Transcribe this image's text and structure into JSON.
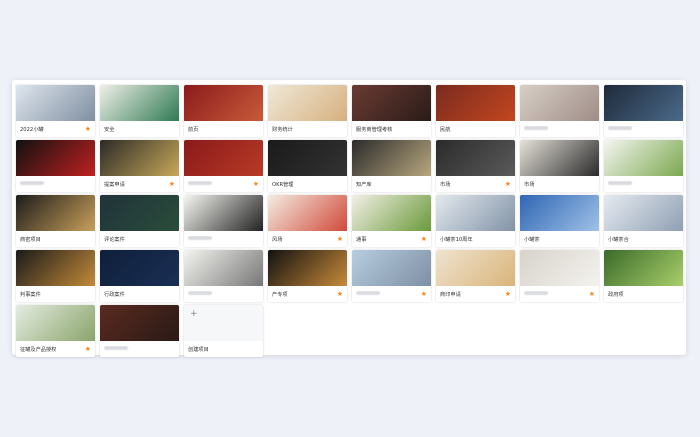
{
  "projects": [
    {
      "title": "2022小罐",
      "starred": true,
      "colors": [
        "#dfe6ee",
        "#7f8fa1"
      ]
    },
    {
      "title": "安全",
      "starred": false,
      "colors": [
        "#f0efe8",
        "#2f7a53"
      ]
    },
    {
      "title": "前页",
      "starred": false,
      "colors": [
        "#8b1b1b",
        "#c85a3a"
      ]
    },
    {
      "title": "财务统计",
      "starred": false,
      "colors": [
        "#efe8d8",
        "#d6b07e"
      ]
    },
    {
      "title": "服务商管理考核",
      "starred": false,
      "colors": [
        "#6a3b32",
        "#2b1b18"
      ]
    },
    {
      "title": "民航",
      "starred": false,
      "colors": [
        "#7a2a1f",
        "#c3471f"
      ]
    },
    {
      "title": "",
      "starred": false,
      "colors": [
        "#d7cfc7",
        "#9f8d86"
      ]
    },
    {
      "title": "",
      "starred": false,
      "colors": [
        "#1f2a3a",
        "#4b6a8a"
      ]
    },
    {
      "title": "",
      "starred": false,
      "colors": [
        "#111",
        "#c02020"
      ]
    },
    {
      "title": "提案申请",
      "starred": true,
      "colors": [
        "#2b2a27",
        "#c8a85a"
      ]
    },
    {
      "title": "",
      "starred": true,
      "colors": [
        "#8a1a1a",
        "#b83a26"
      ]
    },
    {
      "title": "OKR管理",
      "starred": false,
      "colors": [
        "#1a1a1a",
        "#333"
      ]
    },
    {
      "title": "知产库",
      "starred": false,
      "colors": [
        "#2b2b2b",
        "#b8a77e"
      ]
    },
    {
      "title": "市场",
      "starred": true,
      "colors": [
        "#2b2b2b",
        "#5a5a5a"
      ]
    },
    {
      "title": "市场",
      "starred": false,
      "colors": [
        "#e6e2da",
        "#2a2a2a"
      ]
    },
    {
      "title": "",
      "starred": false,
      "colors": [
        "#f5f5f2",
        "#7ba84e"
      ]
    },
    {
      "title": "商密项目",
      "starred": false,
      "colors": [
        "#1c1c1c",
        "#c9a05a"
      ]
    },
    {
      "title": "评论案件",
      "starred": false,
      "colors": [
        "#20323a",
        "#2a4d3a"
      ]
    },
    {
      "title": "",
      "starred": false,
      "colors": [
        "#f7f7f2",
        "#222"
      ]
    },
    {
      "title": "风场",
      "starred": true,
      "colors": [
        "#f3ece2",
        "#d04a3a"
      ]
    },
    {
      "title": "通事",
      "starred": true,
      "colors": [
        "#f3efe6",
        "#6a9a3a"
      ]
    },
    {
      "title": "小罐茶10周年",
      "starred": false,
      "colors": [
        "#e3e8ee",
        "#8193a6"
      ]
    },
    {
      "title": "小罐茶",
      "starred": false,
      "colors": [
        "#2f66b3",
        "#9fc1e8"
      ]
    },
    {
      "title": "小罐茶合",
      "starred": false,
      "colors": [
        "#e6eaf0",
        "#8fa0b3"
      ]
    },
    {
      "title": "判事案件",
      "starred": false,
      "colors": [
        "#1a1a1a",
        "#c48a3a"
      ]
    },
    {
      "title": "行政案件",
      "starred": false,
      "colors": [
        "#0f1f3a",
        "#1b2f55"
      ]
    },
    {
      "title": "",
      "starred": false,
      "colors": [
        "#f4f4f0",
        "#777"
      ]
    },
    {
      "title": "产专项",
      "starred": true,
      "colors": [
        "#111",
        "#c88a3a"
      ]
    },
    {
      "title": "",
      "starred": true,
      "colors": [
        "#b8cde0",
        "#7d8fa4"
      ]
    },
    {
      "title": "商印申请",
      "starred": true,
      "colors": [
        "#efe3cf",
        "#d9b57a"
      ]
    },
    {
      "title": "",
      "starred": true,
      "colors": [
        "#d7d3cb",
        "#f4f2ee"
      ]
    },
    {
      "title": "政府项",
      "starred": false,
      "colors": [
        "#3a6a2a",
        "#a9cf6a"
      ]
    },
    {
      "title": "征罐及产品授权",
      "starred": true,
      "colors": [
        "#e4ece1",
        "#8aa46a"
      ]
    },
    {
      "title": "",
      "starred": false,
      "colors": [
        "#5a2a20",
        "#2a1a16"
      ]
    }
  ],
  "create_project": {
    "label": "创建项目",
    "icon": "plus-icon"
  }
}
